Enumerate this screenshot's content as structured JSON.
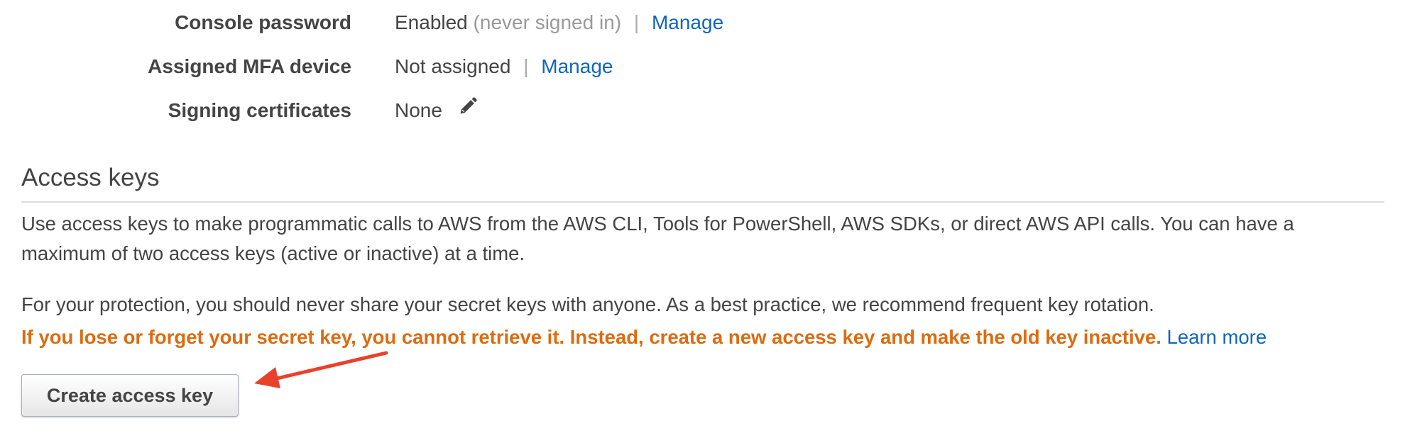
{
  "details": {
    "console_password": {
      "label": "Console password",
      "value": "Enabled",
      "note": "(never signed in)",
      "separator": "|",
      "link": "Manage"
    },
    "mfa_device": {
      "label": "Assigned MFA device",
      "value": "Not assigned",
      "separator": "|",
      "link": "Manage"
    },
    "signing_certificates": {
      "label": "Signing certificates",
      "value": "None",
      "icon": "pencil-icon"
    }
  },
  "access_keys": {
    "title": "Access keys",
    "description": "Use access keys to make programmatic calls to AWS from the AWS CLI, Tools for PowerShell, AWS SDKs, or direct AWS API calls. You can have a maximum of two access keys (active or inactive) at a time.",
    "protection_text": "For your protection, you should never share your secret keys with anyone. As a best practice, we recommend frequent key rotation.",
    "warning_text": "If you lose or forget your secret key, you cannot retrieve it. Instead, create a new access key and make the old key inactive.",
    "learn_more_link": "Learn more",
    "create_button_label": "Create access key"
  },
  "colors": {
    "link": "#1166bb",
    "warning": "#dd6b10",
    "annotation_arrow": "#e8412c"
  }
}
